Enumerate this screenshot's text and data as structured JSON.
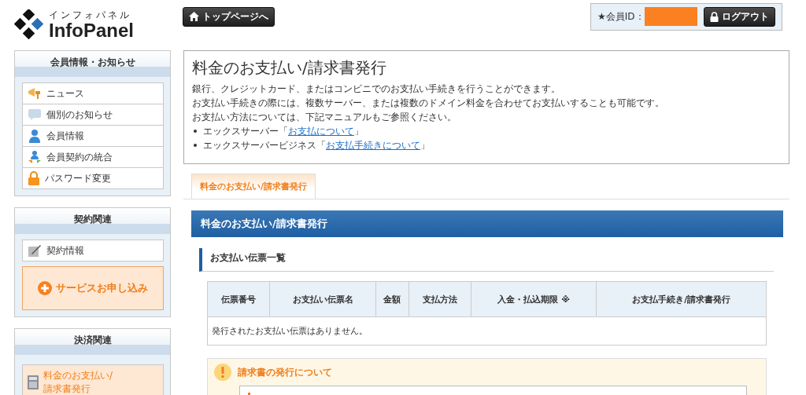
{
  "header": {
    "logo_kana": "インフォパネル",
    "logo_text": "InfoPanel",
    "top_button": "トップページへ",
    "member_label": "★会員ID：",
    "logout_button": "ログアウト"
  },
  "sidebar": [
    {
      "title": "会員情報・お知らせ",
      "items": [
        {
          "label": "ニュース",
          "selected": false
        },
        {
          "label": "個別のお知らせ",
          "selected": false
        },
        {
          "label": "会員情報",
          "selected": false
        },
        {
          "label": "会員契約の統合",
          "selected": false
        },
        {
          "label": "パスワード変更",
          "selected": false
        }
      ]
    },
    {
      "title": "契約関連",
      "items": [
        {
          "label": "契約情報",
          "selected": false
        }
      ],
      "cta": "サービスお申し込み"
    },
    {
      "title": "決済関連",
      "items": [
        {
          "label": "料金のお支払い/請求書発行",
          "selected": true
        }
      ]
    }
  ],
  "intro": {
    "title": "料金のお支払い/請求書発行",
    "paragraphs": [
      "銀行、クレジットカード、またはコンビニでのお支払い手続きを行うことができます。",
      "お支払い手続きの際には、複数サーバー、または複数のドメイン料金を合わせてお支払いすることも可能です。",
      "お支払い方法については、下記マニュアルもご参照ください。"
    ],
    "links": [
      {
        "prefix": "エックスサーバー「",
        "link": "お支払について",
        "suffix": "」"
      },
      {
        "prefix": "エックスサーバービジネス「",
        "link": "お支払手続きについて",
        "suffix": "」"
      }
    ]
  },
  "tabs": [
    {
      "label": "料金のお支払い/請求書発行",
      "selected": true
    }
  ],
  "section_bar": "料金のお支払い/請求書発行",
  "subheading": "お支払い伝票一覧",
  "table": {
    "columns": [
      "伝票番号",
      "お支払い伝票名",
      "金額",
      "支払方法",
      "入金・払込期限 ※",
      "お支払手続き/請求書発行"
    ],
    "empty_message": "発行されたお支払い伝票はありません。"
  },
  "notice": {
    "title": "請求書の発行について"
  }
}
